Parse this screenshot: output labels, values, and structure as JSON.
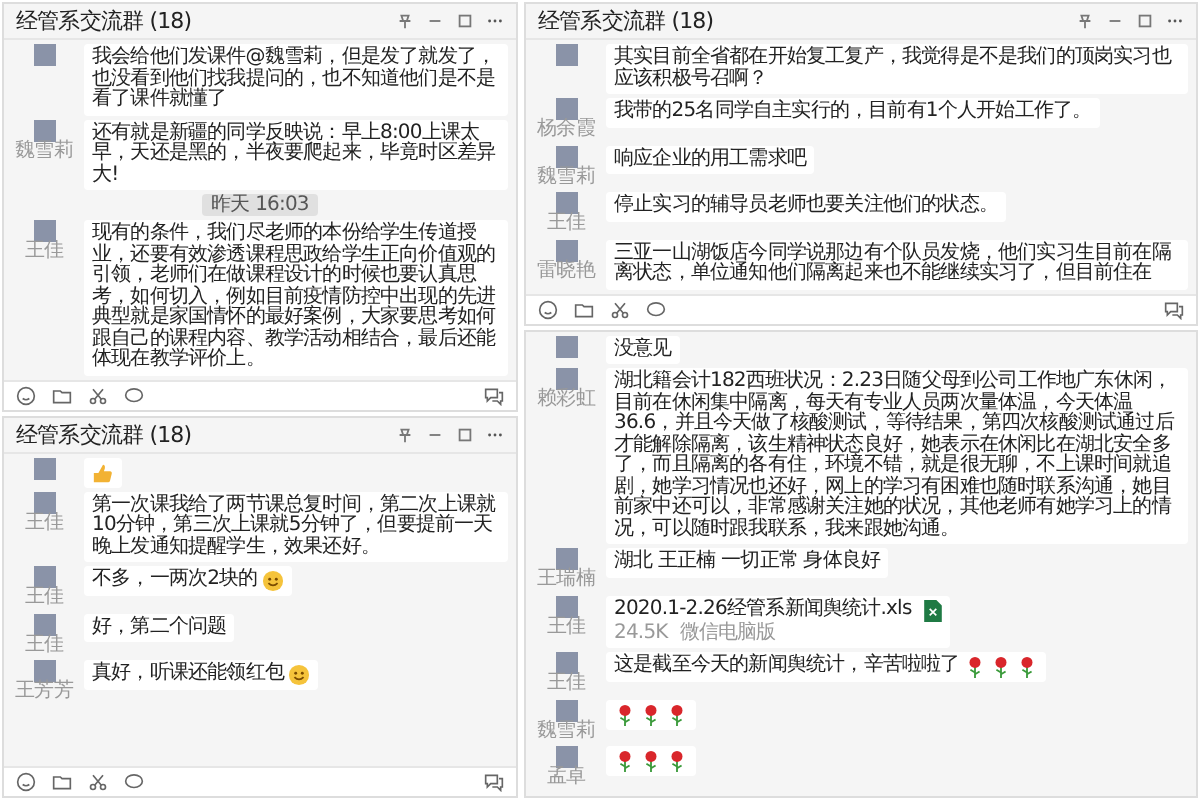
{
  "panels": [
    {
      "title": "经管系交流群 (18)",
      "messages": [
        {
          "kind": "text",
          "text": "我会给他们发课件@魏雪莉，但是发了就发了，也没看到他们找我提问的，也不知道他们是不是看了课件就懂了"
        },
        {
          "kind": "text",
          "sender": "魏雪莉",
          "text": "还有就是新疆的同学反映说：早上8:00上课太早，天还是黑的，半夜要爬起来，毕竟时区差异大!"
        },
        {
          "kind": "time",
          "text": "昨天 16:03"
        },
        {
          "kind": "text",
          "sender": "王佳",
          "text": "现有的条件，我们尽老师的本份给学生传道授业，还要有效渗透课程思政给学生正向价值观的引领，老师们在做课程设计的时候也要认真思考，如何切入，例如目前疫情防控中出现的先进典型就是家国情怀的最好案例，大家要思考如何跟自己的课程内容、教学活动相结合，最后还能体现在教学评价上。"
        }
      ]
    },
    {
      "title": "经管系交流群 (18)",
      "messages": [
        {
          "kind": "thumbs"
        },
        {
          "kind": "text",
          "sender": "王佳",
          "text": "第一次课我给了两节课总复时间，第二次上课就10分钟，第三次上课就5分钟了，但要提前一天晚上发通知提醒学生，效果还好。"
        },
        {
          "kind": "text",
          "sender": "王佳",
          "text": "不多，一两次2块的",
          "icons": [
            {
              "kind": "smile"
            }
          ]
        },
        {
          "kind": "text",
          "sender": "王佳",
          "text": "好，第二个问题"
        },
        {
          "kind": "text",
          "sender": "王芳芳",
          "text": "真好，听课还能领红包",
          "icons": [
            {
              "kind": "smile"
            }
          ]
        }
      ]
    },
    {
      "title": "经管系交流群 (18)",
      "messages": [
        {
          "kind": "text",
          "text": "其实目前全省都在开始复工复产，我觉得是不是我们的顶岗实习也应该积极号召啊？"
        },
        {
          "kind": "text",
          "sender": "杨余霞",
          "text": "我带的25名同学自主实行的，目前有1个人开始工作了。"
        },
        {
          "kind": "text",
          "sender": "魏雪莉",
          "text": "响应企业的用工需求吧"
        },
        {
          "kind": "text",
          "sender": "王佳",
          "text": "停止实习的辅导员老师也要关注他们的状态。"
        },
        {
          "kind": "text",
          "sender": "雷晓艳",
          "text": "三亚一山湖饭店今同学说那边有个队员发烧，他们实习生目前在隔离状态，单位通知他们隔离起来也不能继续实习了，但目前住在"
        }
      ]
    },
    {
      "messages": [
        {
          "kind": "text",
          "text": "没意见"
        },
        {
          "kind": "text",
          "sender": "赖彩虹",
          "text": "湖北籍会计182西班状况：2.23日随父母到公司工作地广东休闲，目前在休闲集中隔离，每天有专业人员两次量体温，今天体温36.6，并且今天做了核酸测试，等待结果，第四次核酸测试通过后才能解除隔离，该生精神状态良好，她表示在休闲比在湖北安全多了，而且隔离的各有住，环境不错，就是很无聊，不上课时间就追剧，她学习情况也还好，网上的学习有困难也随时联系沟通，她目前家中还可以，非常感谢关注她的状况，其他老师有她学习上的情况，可以随时跟我联系，我来跟她沟通。"
        },
        {
          "kind": "text",
          "sender": "王瑞楠",
          "text": "湖北 王正楠 一切正常 身体良好"
        },
        {
          "kind": "file",
          "sender": "王佳",
          "file_name": "2020.1-2.26经管系新闻舆统计.xls",
          "size": "24.5K",
          "source": "微信电脑版"
        },
        {
          "kind": "text",
          "sender": "王佳",
          "text": "这是截至今天的新闻舆统计，辛苦啦啦了",
          "icons": [
            {
              "kind": "rose"
            },
            {
              "kind": "rose"
            },
            {
              "kind": "rose"
            }
          ]
        },
        {
          "kind": "text",
          "sender": "魏雪莉",
          "icons": [
            {
              "kind": "rose"
            },
            {
              "kind": "rose"
            },
            {
              "kind": "rose"
            }
          ]
        },
        {
          "kind": "text",
          "sender": "孟卓",
          "icons": [
            {
              "kind": "rose"
            },
            {
              "kind": "rose"
            },
            {
              "kind": "rose"
            }
          ]
        }
      ]
    }
  ]
}
